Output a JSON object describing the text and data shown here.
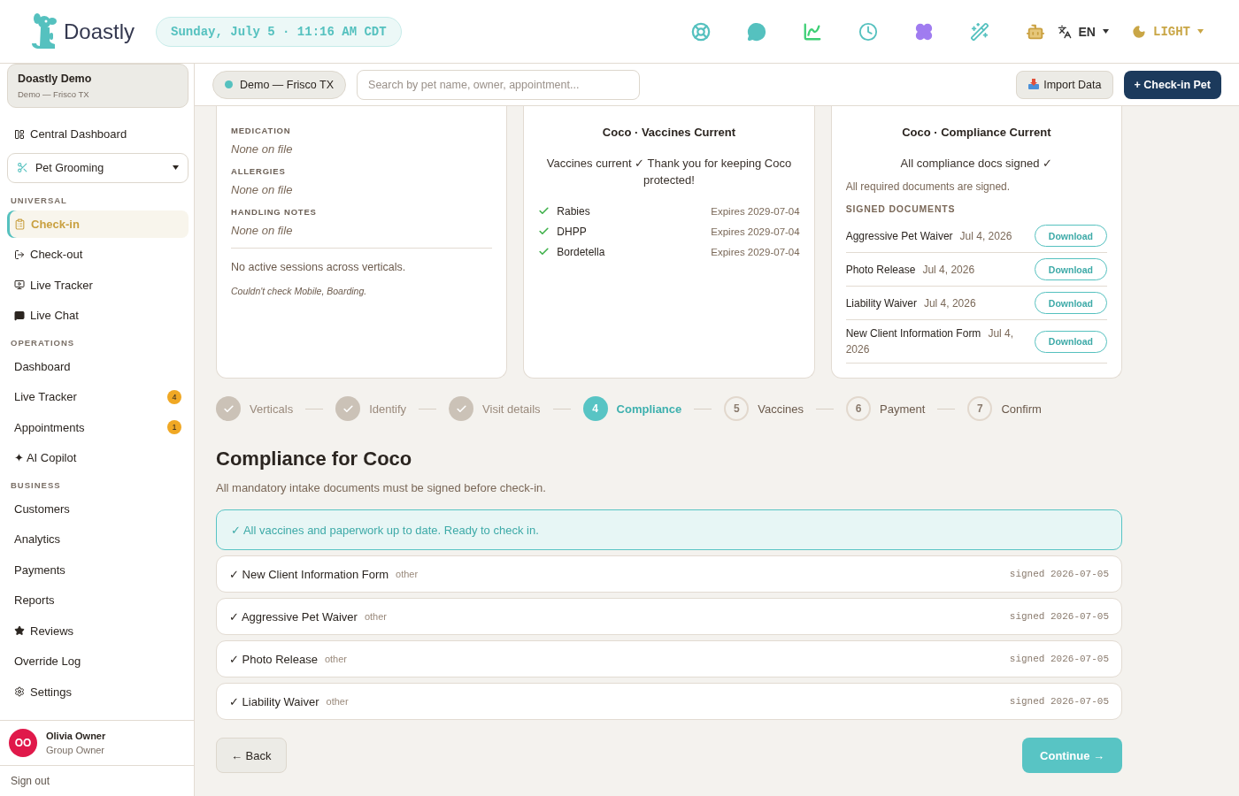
{
  "header": {
    "logo": "Doastly",
    "datetime": "Sunday, July 5 · 11:16 AM CDT",
    "language": "EN",
    "theme": "LIGHT"
  },
  "sidebar": {
    "workspace": {
      "name": "Doastly Demo",
      "location": "Demo — Frisco TX"
    },
    "top_item": {
      "label": "Central Dashboard",
      "selected": false
    },
    "vertical": "Pet Grooming",
    "sections": [
      {
        "title": "UNIVERSAL",
        "items": [
          {
            "label": "Check-in",
            "selected": true
          },
          {
            "label": "Check-out",
            "selected": false
          },
          {
            "label": "Live Tracker",
            "selected": false
          },
          {
            "label": "Live Chat",
            "selected": false
          }
        ]
      },
      {
        "title": "OPERATIONS",
        "items": [
          {
            "label": "Dashboard",
            "selected": false
          },
          {
            "label": "Live Tracker",
            "selected": false,
            "badge": "4"
          },
          {
            "label": "Appointments",
            "selected": false,
            "badge": "1"
          },
          {
            "label": "✦ AI Copilot",
            "selected": false
          }
        ]
      },
      {
        "title": "BUSINESS",
        "items": [
          {
            "label": "Customers",
            "selected": false
          },
          {
            "label": "Analytics",
            "selected": false
          },
          {
            "label": "Payments",
            "selected": false
          },
          {
            "label": "Reports",
            "selected": false
          },
          {
            "label": "Reviews",
            "selected": false
          },
          {
            "label": "Override Log",
            "selected": false
          },
          {
            "label": "Settings",
            "selected": false
          }
        ]
      }
    ],
    "user": {
      "initials": "OO",
      "name": "Olivia Owner",
      "role": "Group Owner"
    },
    "sign_out": "Sign out"
  },
  "toolbar": {
    "location": "Demo — Frisco TX",
    "search": {
      "placeholder": "Search by pet name, owner, appointment..."
    },
    "import_button": "Import Data",
    "checkin_button": "+ Check-in Pet"
  },
  "medical_card": {
    "fields": [
      {
        "label": "MEDICATION",
        "value": "None on file"
      },
      {
        "label": "ALLERGIES",
        "value": "None on file"
      },
      {
        "label": "HANDLING NOTES",
        "value": "None on file"
      }
    ],
    "sessions": "No active sessions across verticals.",
    "note": "Couldn't check Mobile, Boarding."
  },
  "vaccines_card": {
    "title": "Coco · Vaccines Current",
    "message": "Vaccines current ✓ Thank you for keeping Coco protected!",
    "vaccines": [
      {
        "name": "Rabies",
        "expires": "Expires 2029-07-04"
      },
      {
        "name": "DHPP",
        "expires": "Expires 2029-07-04"
      },
      {
        "name": "Bordetella",
        "expires": "Expires 2029-07-04"
      }
    ]
  },
  "compliance_card": {
    "title": "Coco · Compliance Current",
    "message": "All compliance docs signed ✓",
    "summary": "All required documents are signed.",
    "section_title": "SIGNED DOCUMENTS",
    "documents": [
      {
        "name": "Aggressive Pet Waiver",
        "date": "Jul 4, 2026",
        "action": "Download"
      },
      {
        "name": "Photo Release",
        "date": "Jul 4, 2026",
        "action": "Download"
      },
      {
        "name": "Liability Waiver",
        "date": "Jul 4, 2026",
        "action": "Download"
      },
      {
        "name": "New Client Information Form",
        "date": "Jul 4, 2026",
        "action": "Download"
      }
    ]
  },
  "stepper": {
    "steps": [
      {
        "label": "Verticals",
        "done": true,
        "selected": false
      },
      {
        "label": "Identify",
        "done": true,
        "selected": false
      },
      {
        "label": "Visit details",
        "done": true,
        "selected": false
      },
      {
        "number": "4",
        "label": "Compliance",
        "done": false,
        "selected": true
      },
      {
        "number": "5",
        "label": "Vaccines",
        "done": false,
        "selected": false
      },
      {
        "number": "6",
        "label": "Payment",
        "done": false,
        "selected": false
      },
      {
        "number": "7",
        "label": "Confirm",
        "done": false,
        "selected": false
      }
    ]
  },
  "title": "Compliance for Coco",
  "subtitle": "All mandatory intake documents must be signed before check-in.",
  "banner": "✓ All vaccines and paperwork up to date. Ready to check in.",
  "documents": [
    {
      "name": "✓ New Client Information Form",
      "type": "other",
      "signed": "signed 2026-07-05"
    },
    {
      "name": "✓ Aggressive Pet Waiver",
      "type": "other",
      "signed": "signed 2026-07-05"
    },
    {
      "name": "✓ Photo Release",
      "type": "other",
      "signed": "signed 2026-07-05"
    },
    {
      "name": "✓ Liability Waiver",
      "type": "other",
      "signed": "signed 2026-07-05"
    }
  ],
  "back_button": "← Back",
  "continue_button": "Continue →"
}
